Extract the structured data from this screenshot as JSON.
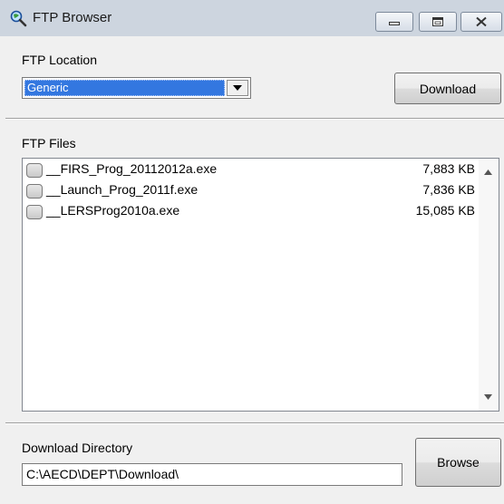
{
  "window": {
    "title": "FTP Browser",
    "icon": "magnifier-globe-icon",
    "controls": [
      "minimize-icon",
      "maximize-icon",
      "close-icon"
    ]
  },
  "location": {
    "label": "FTP Location",
    "selected": "Generic"
  },
  "download_button": "Download",
  "files": {
    "label": "FTP Files",
    "items": [
      {
        "name": "__FIRS_Prog_20112012a.exe",
        "size": "7,883 KB",
        "checked": false
      },
      {
        "name": "__Launch_Prog_2011f.exe",
        "size": "7,836 KB",
        "checked": false
      },
      {
        "name": "__LERSProg2010a.exe",
        "size": "15,085 KB",
        "checked": false
      }
    ]
  },
  "directory": {
    "label": "Download Directory",
    "value": "C:\\AECD\\DEPT\\Download\\"
  },
  "browse_button": "Browse",
  "colors": {
    "selection": "#3377e0",
    "titlebar": "#cdd5df"
  }
}
